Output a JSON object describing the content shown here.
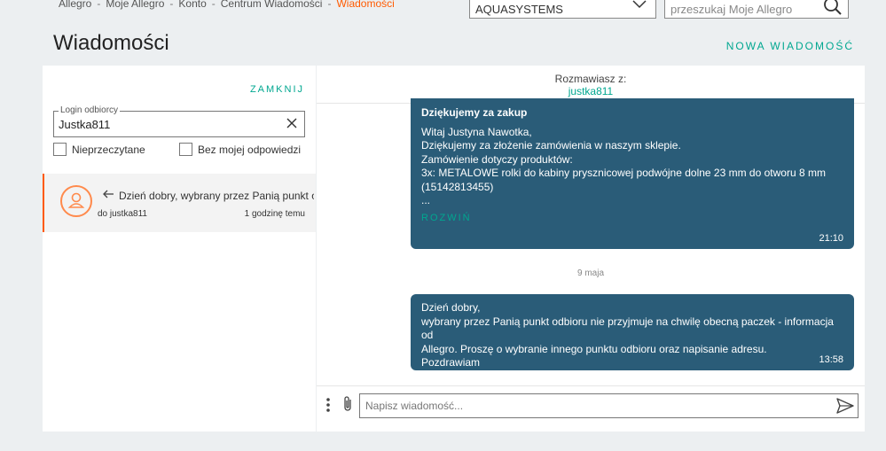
{
  "breadcrumb": {
    "items": [
      "Allegro",
      "Moje Allegro",
      "Konto",
      "Centrum Wiadomości"
    ],
    "separator": "-",
    "current": "Wiadomości"
  },
  "header": {
    "account_select_value": "AQUASYSTEMS",
    "search_placeholder": "przeszukaj Moje Allegro",
    "page_title": "Wiadomości",
    "new_message_label": "NOWA WIADOMOŚĆ"
  },
  "sidebar": {
    "close_label": "ZAMKNIJ",
    "login_legend": "Login odbiorcy",
    "login_value": "Justka811",
    "filter_unread": "Nieprzeczytane",
    "filter_no_reply": "Bez mojej odpowiedzi",
    "thread": {
      "preview": "Dzień dobry, wybrany przez Panią punkt o...",
      "to": "do justka811",
      "ago": "1 godzinę temu"
    }
  },
  "conversation": {
    "header_label": "Rozmawiasz z:",
    "user": "justka811",
    "messages": [
      {
        "title": "Dziękujemy za zakup",
        "lines": [
          "Witaj Justyna Nawotka,",
          "Dziękujemy za złożenie zamówienia w naszym sklepie.",
          "Zamówienie dotyczy produktów:",
          "3x: METALOWE rolki do kabiny prysznicowej podwójne dolne 23 mm do otworu 8 mm",
          "(15142813455)",
          "..."
        ],
        "expand_label": "ROZWIŃ",
        "time": "21:10"
      },
      {
        "lines": [
          "Dzień dobry,",
          "wybrany przez Panią punkt odbioru nie przyjmuje na chwilę obecną paczek - informacja od",
          "Allegro. Proszę o wybranie innego punktu odbioru oraz napisanie adresu.",
          "Pozdrawiam"
        ],
        "time": "13:58"
      }
    ],
    "date_separator": "9 maja",
    "composer_placeholder": "Napisz wiadomość..."
  },
  "colors": {
    "accent": "#00a790",
    "brand_orange": "#ff5a00",
    "bubble": "#2a5c78"
  }
}
